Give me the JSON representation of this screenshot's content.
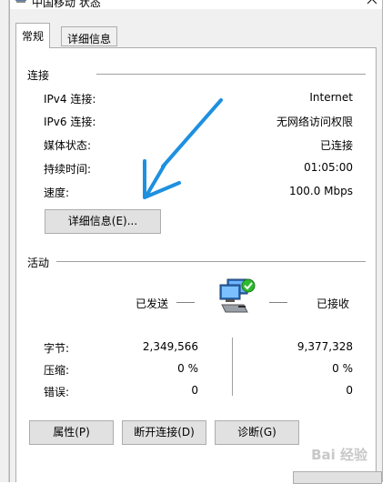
{
  "window": {
    "title": "中国移动 状态"
  },
  "tabs": [
    {
      "label": "常规"
    },
    {
      "label": "详细信息"
    }
  ],
  "connection": {
    "group_label": "连接",
    "rows": [
      {
        "label": "IPv4 连接:",
        "value": "Internet"
      },
      {
        "label": "IPv6 连接:",
        "value": "无网络访问权限"
      },
      {
        "label": "媒体状态:",
        "value": "已连接"
      },
      {
        "label": "持续时间:",
        "value": "01:05:00"
      },
      {
        "label": "速度:",
        "value": "100.0 Mbps"
      }
    ],
    "details_button": "详细信息(E)..."
  },
  "activity": {
    "group_label": "活动",
    "sent_label": "已发送",
    "received_label": "已接收",
    "rows": [
      {
        "label": "字节:",
        "sent": "2,349,566",
        "received": "9,377,328"
      },
      {
        "label": "压缩:",
        "sent": "0 %",
        "received": "0 %"
      },
      {
        "label": "错误:",
        "sent": "0",
        "received": "0"
      }
    ]
  },
  "buttons": {
    "properties": "属性(P)",
    "disconnect": "断开连接(D)",
    "diagnose": "诊断(G)"
  },
  "watermark": "Bai 经验",
  "colors": {
    "arrow": "#1e90e0",
    "check": "#2eb82e",
    "button_bg": "#e1e1e1"
  },
  "icons": [
    "network-icon",
    "close-icon",
    "network-computers-icon",
    "arrow-annotation"
  ]
}
